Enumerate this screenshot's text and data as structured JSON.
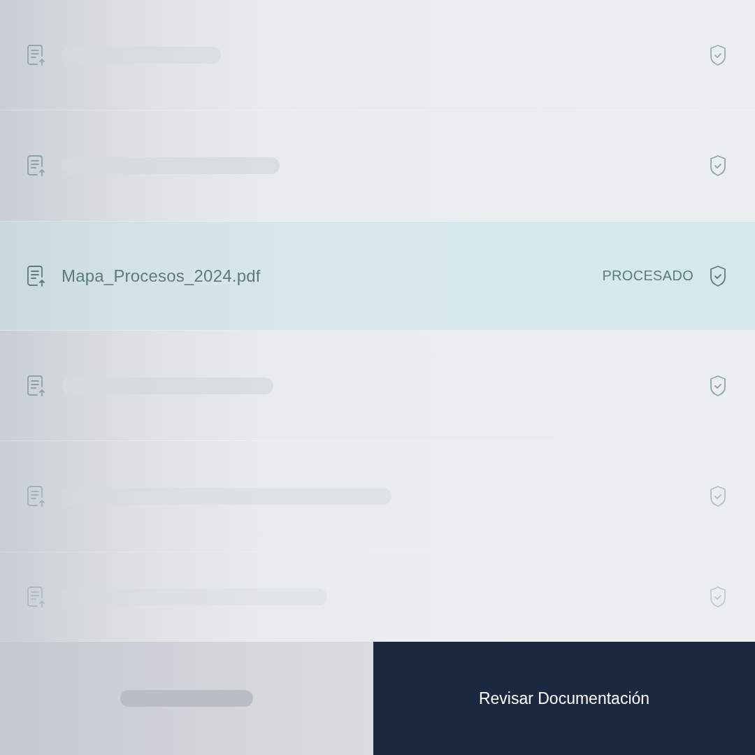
{
  "rows": [
    {
      "kind": "skeleton",
      "selected": false
    },
    {
      "kind": "skeleton",
      "selected": false
    },
    {
      "kind": "file",
      "selected": true,
      "name": "Mapa_Procesos_2024.pdf",
      "status": "PROCESADO"
    },
    {
      "kind": "skeleton",
      "selected": false
    },
    {
      "kind": "skeleton",
      "selected": false
    },
    {
      "kind": "skeleton",
      "selected": false
    }
  ],
  "footer": {
    "primary_button": "Revisar Documentación"
  }
}
